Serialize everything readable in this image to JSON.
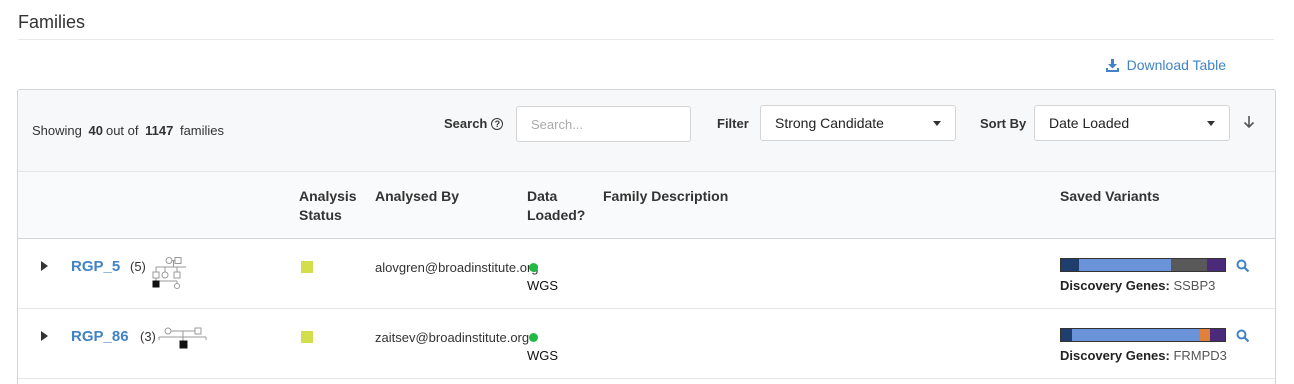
{
  "page": {
    "title": "Families",
    "download_label": "Download Table"
  },
  "toolbar": {
    "showing_prefix": "Showing",
    "shown_count": "40",
    "out_of": "out of",
    "total_count": "1147",
    "families_word": "families",
    "search_label": "Search",
    "search_placeholder": "Search...",
    "filter_label": "Filter",
    "filter_value": "Strong Candidate",
    "sort_label": "Sort By",
    "sort_value": "Date Loaded"
  },
  "columns": {
    "analysis_status": [
      "Analysis",
      "Status"
    ],
    "analysed_by": "Analysed By",
    "data_loaded": [
      "Data",
      "Loaded?"
    ],
    "family_description": "Family Description",
    "saved_variants": "Saved Variants"
  },
  "rows": [
    {
      "family": "RGP_5",
      "count": "(5)",
      "status_color": "#d4de4a",
      "analysed_by": "alovgren@broadinstitute.org",
      "data_type": "WGS",
      "discovery_label": "Discovery Genes:",
      "discovery_genes": "SSBP3",
      "variant_segments": [
        {
          "color": "#1f3e6e",
          "fraction": 0.11
        },
        {
          "color": "#6a93d9",
          "fraction": 0.56
        },
        {
          "color": "#595959",
          "fraction": 0.22
        },
        {
          "color": "#4b2a7b",
          "fraction": 0.11
        }
      ]
    },
    {
      "family": "RGP_86",
      "count": "(3)",
      "status_color": "#d4de4a",
      "analysed_by": "zaitsev@broadinstitute.org",
      "data_type": "WGS",
      "discovery_label": "Discovery Genes:",
      "discovery_genes": "FRMPD3",
      "variant_segments": [
        {
          "color": "#1f3e6e",
          "fraction": 0.07
        },
        {
          "color": "#6a93d9",
          "fraction": 0.78
        },
        {
          "color": "#e0803a",
          "fraction": 0.06
        },
        {
          "color": "#4b2a7b",
          "fraction": 0.09
        }
      ]
    }
  ],
  "colors": {
    "link": "#4183c4",
    "status_dot": "#21ba45"
  },
  "icons": [
    "download-icon",
    "help-circle-icon",
    "caret-down-icon",
    "sort-direction-arrow-icon",
    "expand-triangle-icon",
    "pedigree-icon",
    "magnifier-icon"
  ]
}
